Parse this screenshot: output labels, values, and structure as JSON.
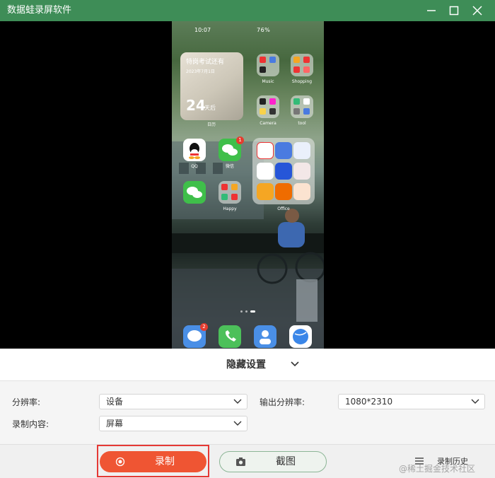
{
  "window": {
    "title": "数据蛙录屏软件",
    "accent": "#3e8d57",
    "icons": [
      "minimize-icon",
      "maximize-icon",
      "close-icon"
    ]
  },
  "phone": {
    "status_time": "10:07",
    "status_right": "76%",
    "widget": {
      "title": "特岗考试还有",
      "date": "2023年7月1日",
      "days": "24",
      "unit": "天后",
      "caption": "日历"
    },
    "apps": {
      "music": "Music",
      "shopping": "Shopping",
      "camera": "Camera",
      "tool": "tool",
      "qq": "QQ",
      "wechat": "微信",
      "wechat_badge": "1",
      "happy": "Happy",
      "office": "Office",
      "messages_badge": "2"
    }
  },
  "panel": {
    "hide_settings": "隐藏设置",
    "resolution_label": "分辨率:",
    "resolution_value": "设备",
    "output_resolution_label": "输出分辨率:",
    "output_resolution_value": "1080*2310",
    "record_content_label": "录制内容:",
    "record_content_value": "屏幕",
    "record_button": "录制",
    "screenshot_button": "截图",
    "history_button": "录制历史",
    "watermark": "@稀土掘金技术社区",
    "record_color": "#ef5533",
    "highlight_color": "#e53935"
  }
}
